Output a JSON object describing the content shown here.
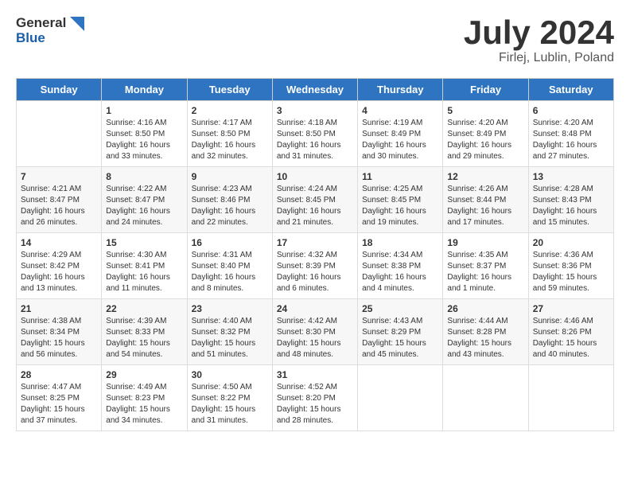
{
  "header": {
    "logo_line1": "General",
    "logo_line2": "Blue",
    "month_title": "July 2024",
    "location": "Firlej, Lublin, Poland"
  },
  "days_of_week": [
    "Sunday",
    "Monday",
    "Tuesday",
    "Wednesday",
    "Thursday",
    "Friday",
    "Saturday"
  ],
  "weeks": [
    [
      {
        "day": "",
        "sunrise": "",
        "sunset": "",
        "daylight": ""
      },
      {
        "day": "1",
        "sunrise": "Sunrise: 4:16 AM",
        "sunset": "Sunset: 8:50 PM",
        "daylight": "Daylight: 16 hours and 33 minutes."
      },
      {
        "day": "2",
        "sunrise": "Sunrise: 4:17 AM",
        "sunset": "Sunset: 8:50 PM",
        "daylight": "Daylight: 16 hours and 32 minutes."
      },
      {
        "day": "3",
        "sunrise": "Sunrise: 4:18 AM",
        "sunset": "Sunset: 8:50 PM",
        "daylight": "Daylight: 16 hours and 31 minutes."
      },
      {
        "day": "4",
        "sunrise": "Sunrise: 4:19 AM",
        "sunset": "Sunset: 8:49 PM",
        "daylight": "Daylight: 16 hours and 30 minutes."
      },
      {
        "day": "5",
        "sunrise": "Sunrise: 4:20 AM",
        "sunset": "Sunset: 8:49 PM",
        "daylight": "Daylight: 16 hours and 29 minutes."
      },
      {
        "day": "6",
        "sunrise": "Sunrise: 4:20 AM",
        "sunset": "Sunset: 8:48 PM",
        "daylight": "Daylight: 16 hours and 27 minutes."
      }
    ],
    [
      {
        "day": "7",
        "sunrise": "Sunrise: 4:21 AM",
        "sunset": "Sunset: 8:47 PM",
        "daylight": "Daylight: 16 hours and 26 minutes."
      },
      {
        "day": "8",
        "sunrise": "Sunrise: 4:22 AM",
        "sunset": "Sunset: 8:47 PM",
        "daylight": "Daylight: 16 hours and 24 minutes."
      },
      {
        "day": "9",
        "sunrise": "Sunrise: 4:23 AM",
        "sunset": "Sunset: 8:46 PM",
        "daylight": "Daylight: 16 hours and 22 minutes."
      },
      {
        "day": "10",
        "sunrise": "Sunrise: 4:24 AM",
        "sunset": "Sunset: 8:45 PM",
        "daylight": "Daylight: 16 hours and 21 minutes."
      },
      {
        "day": "11",
        "sunrise": "Sunrise: 4:25 AM",
        "sunset": "Sunset: 8:45 PM",
        "daylight": "Daylight: 16 hours and 19 minutes."
      },
      {
        "day": "12",
        "sunrise": "Sunrise: 4:26 AM",
        "sunset": "Sunset: 8:44 PM",
        "daylight": "Daylight: 16 hours and 17 minutes."
      },
      {
        "day": "13",
        "sunrise": "Sunrise: 4:28 AM",
        "sunset": "Sunset: 8:43 PM",
        "daylight": "Daylight: 16 hours and 15 minutes."
      }
    ],
    [
      {
        "day": "14",
        "sunrise": "Sunrise: 4:29 AM",
        "sunset": "Sunset: 8:42 PM",
        "daylight": "Daylight: 16 hours and 13 minutes."
      },
      {
        "day": "15",
        "sunrise": "Sunrise: 4:30 AM",
        "sunset": "Sunset: 8:41 PM",
        "daylight": "Daylight: 16 hours and 11 minutes."
      },
      {
        "day": "16",
        "sunrise": "Sunrise: 4:31 AM",
        "sunset": "Sunset: 8:40 PM",
        "daylight": "Daylight: 16 hours and 8 minutes."
      },
      {
        "day": "17",
        "sunrise": "Sunrise: 4:32 AM",
        "sunset": "Sunset: 8:39 PM",
        "daylight": "Daylight: 16 hours and 6 minutes."
      },
      {
        "day": "18",
        "sunrise": "Sunrise: 4:34 AM",
        "sunset": "Sunset: 8:38 PM",
        "daylight": "Daylight: 16 hours and 4 minutes."
      },
      {
        "day": "19",
        "sunrise": "Sunrise: 4:35 AM",
        "sunset": "Sunset: 8:37 PM",
        "daylight": "Daylight: 16 hours and 1 minute."
      },
      {
        "day": "20",
        "sunrise": "Sunrise: 4:36 AM",
        "sunset": "Sunset: 8:36 PM",
        "daylight": "Daylight: 15 hours and 59 minutes."
      }
    ],
    [
      {
        "day": "21",
        "sunrise": "Sunrise: 4:38 AM",
        "sunset": "Sunset: 8:34 PM",
        "daylight": "Daylight: 15 hours and 56 minutes."
      },
      {
        "day": "22",
        "sunrise": "Sunrise: 4:39 AM",
        "sunset": "Sunset: 8:33 PM",
        "daylight": "Daylight: 15 hours and 54 minutes."
      },
      {
        "day": "23",
        "sunrise": "Sunrise: 4:40 AM",
        "sunset": "Sunset: 8:32 PM",
        "daylight": "Daylight: 15 hours and 51 minutes."
      },
      {
        "day": "24",
        "sunrise": "Sunrise: 4:42 AM",
        "sunset": "Sunset: 8:30 PM",
        "daylight": "Daylight: 15 hours and 48 minutes."
      },
      {
        "day": "25",
        "sunrise": "Sunrise: 4:43 AM",
        "sunset": "Sunset: 8:29 PM",
        "daylight": "Daylight: 15 hours and 45 minutes."
      },
      {
        "day": "26",
        "sunrise": "Sunrise: 4:44 AM",
        "sunset": "Sunset: 8:28 PM",
        "daylight": "Daylight: 15 hours and 43 minutes."
      },
      {
        "day": "27",
        "sunrise": "Sunrise: 4:46 AM",
        "sunset": "Sunset: 8:26 PM",
        "daylight": "Daylight: 15 hours and 40 minutes."
      }
    ],
    [
      {
        "day": "28",
        "sunrise": "Sunrise: 4:47 AM",
        "sunset": "Sunset: 8:25 PM",
        "daylight": "Daylight: 15 hours and 37 minutes."
      },
      {
        "day": "29",
        "sunrise": "Sunrise: 4:49 AM",
        "sunset": "Sunset: 8:23 PM",
        "daylight": "Daylight: 15 hours and 34 minutes."
      },
      {
        "day": "30",
        "sunrise": "Sunrise: 4:50 AM",
        "sunset": "Sunset: 8:22 PM",
        "daylight": "Daylight: 15 hours and 31 minutes."
      },
      {
        "day": "31",
        "sunrise": "Sunrise: 4:52 AM",
        "sunset": "Sunset: 8:20 PM",
        "daylight": "Daylight: 15 hours and 28 minutes."
      },
      {
        "day": "",
        "sunrise": "",
        "sunset": "",
        "daylight": ""
      },
      {
        "day": "",
        "sunrise": "",
        "sunset": "",
        "daylight": ""
      },
      {
        "day": "",
        "sunrise": "",
        "sunset": "",
        "daylight": ""
      }
    ]
  ]
}
